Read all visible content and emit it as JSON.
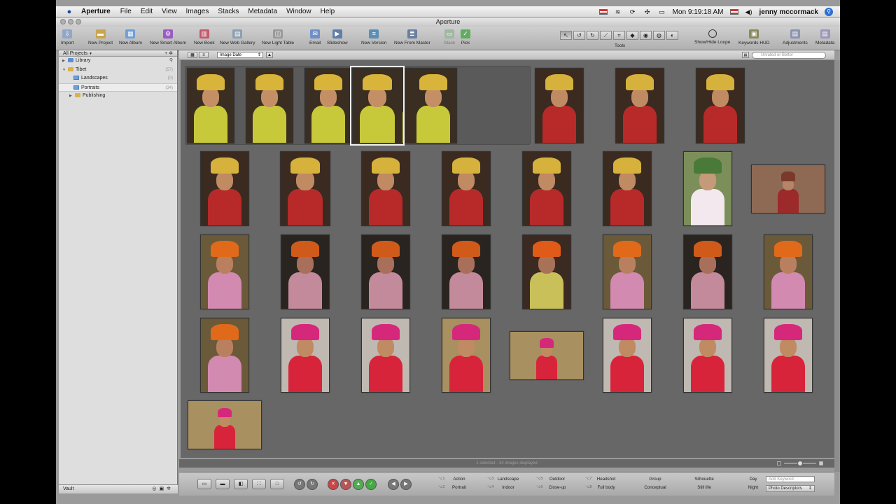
{
  "menubar": {
    "app": "Aperture",
    "items": [
      "File",
      "Edit",
      "View",
      "Images",
      "Stacks",
      "Metadata",
      "Window",
      "Help"
    ],
    "clock": "Mon 9:19:18 AM",
    "user": "jenny mccormack"
  },
  "window": {
    "title": "Aperture"
  },
  "toolbar": {
    "buttons": [
      {
        "label": "Import",
        "icon": "import-icon",
        "color": "#8fa8c8"
      },
      {
        "label": "New Project",
        "icon": "new-project-icon",
        "color": "#c9a550"
      },
      {
        "label": "New Album",
        "icon": "new-album-icon",
        "color": "#6e9fd6"
      },
      {
        "label": "New Smart Album",
        "icon": "new-smart-album-icon",
        "color": "#9a5cc2"
      },
      {
        "label": "New Book",
        "icon": "new-book-icon",
        "color": "#c25a6b"
      },
      {
        "label": "New Web Gallery",
        "icon": "new-web-gallery-icon",
        "color": "#8ca0b5"
      },
      {
        "label": "New Light Table",
        "icon": "new-light-table-icon",
        "color": "#9a9a9a"
      },
      {
        "label": "Email",
        "icon": "email-icon",
        "color": "#6f8fc9"
      },
      {
        "label": "Slideshow",
        "icon": "slideshow-icon",
        "color": "#5f7fa8"
      },
      {
        "label": "New Version",
        "icon": "new-version-icon",
        "color": "#5a8fb8"
      },
      {
        "label": "New From Master",
        "icon": "new-from-master-icon",
        "color": "#6a7fa0"
      },
      {
        "label": "Stack",
        "icon": "stack-icon",
        "color": "#a0b8a0"
      },
      {
        "label": "Pick",
        "icon": "pick-icon",
        "color": "#5fae5f"
      }
    ],
    "tools_label": "Tools",
    "right_buttons": [
      {
        "label": "Show/Hide Loupe",
        "icon": "loupe-icon"
      },
      {
        "label": "Keywords HUD",
        "icon": "keywords-hud-icon"
      },
      {
        "label": "Adjustments",
        "icon": "adjustments-icon"
      },
      {
        "label": "Metadata",
        "icon": "metadata-icon"
      }
    ]
  },
  "sidebar": {
    "header": "All Projects",
    "items": [
      {
        "label": "Library",
        "count": "",
        "icon": "library-icon",
        "level": 0,
        "expanded": false
      },
      {
        "label": "Tibet",
        "count": "(57)",
        "icon": "project-folder-icon",
        "level": 0,
        "expanded": true
      },
      {
        "label": "Landscapes",
        "count": "(0)",
        "icon": "album-icon",
        "level": 1
      },
      {
        "label": "Portraits",
        "count": "(34)",
        "icon": "album-icon",
        "level": 1,
        "selected": true
      },
      {
        "label": "Publishing",
        "count": "",
        "icon": "folder-icon",
        "level": 1,
        "expanded": false
      }
    ],
    "vault": "Vault"
  },
  "browser": {
    "sort": "Image Date",
    "filter_placeholder": "Unrated or Better",
    "status": "1 selected - 34 images displayed"
  },
  "controls": {
    "keywords": [
      {
        "key": "⌥1",
        "label": "Action"
      },
      {
        "key": "⌥2",
        "label": "Portrait"
      },
      {
        "key": "⌥3",
        "label": "Landscape"
      },
      {
        "key": "⌥4",
        "label": "Indoor"
      },
      {
        "key": "⌥5",
        "label": "Outdoor"
      },
      {
        "key": "⌥6",
        "label": "Close-up"
      },
      {
        "key": "⌥7",
        "label": "Headshot"
      },
      {
        "key": "⌥8",
        "label": "Full body"
      },
      {
        "label": "Group"
      },
      {
        "label": "Conceptual"
      },
      {
        "label": "Silhouette"
      },
      {
        "label": "Still life"
      },
      {
        "label": "Day"
      },
      {
        "label": "Night"
      }
    ],
    "add_keyword_placeholder": "Add Keyword",
    "preset": "Photo Descriptors"
  }
}
